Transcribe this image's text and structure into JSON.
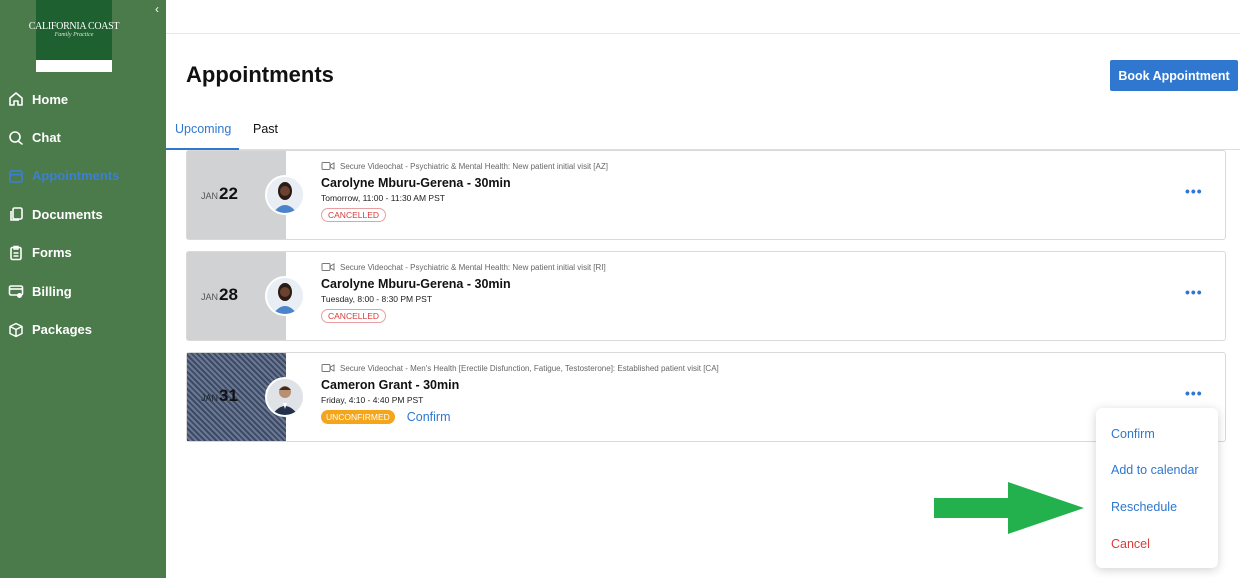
{
  "sidebar": {
    "logo_text": "CALIFORNIA COAST",
    "logo_subtext": "Family Practice",
    "items": [
      {
        "label": "Home",
        "icon": "home-icon"
      },
      {
        "label": "Chat",
        "icon": "chat-icon"
      },
      {
        "label": "Appointments",
        "icon": "calendar-icon",
        "active": true
      },
      {
        "label": "Documents",
        "icon": "documents-icon"
      },
      {
        "label": "Forms",
        "icon": "forms-icon"
      },
      {
        "label": "Billing",
        "icon": "billing-icon"
      },
      {
        "label": "Packages",
        "icon": "packages-icon"
      }
    ]
  },
  "header": {
    "title": "Appointments",
    "book_button": "Book Appointment"
  },
  "tabs": {
    "upcoming": "Upcoming",
    "past": "Past"
  },
  "appointments": [
    {
      "month": "JAN",
      "day": "22",
      "service": "Secure Videochat - Psychiatric & Mental Health: New patient initial visit [AZ]",
      "provider": "Carolyne Mburu-Gerena - 30min",
      "time": "Tomorrow, 11:00 - 11:30 AM PST",
      "status": "CANCELLED"
    },
    {
      "month": "JAN",
      "day": "28",
      "service": "Secure Videochat - Psychiatric & Mental Health: New patient initial visit [RI]",
      "provider": "Carolyne Mburu-Gerena - 30min",
      "time": "Tuesday, 8:00 - 8:30 PM PST",
      "status": "CANCELLED"
    },
    {
      "month": "JAN",
      "day": "31",
      "service": "Secure Videochat - Men's Health [Erectile Disfunction, Fatigue, Testosterone]: Established patient visit [CA]",
      "provider": "Cameron Grant - 30min",
      "time": "Friday, 4:10 - 4:40 PM PST",
      "status": "UNCONFIRMED",
      "confirm_label": "Confirm"
    }
  ],
  "menu": {
    "confirm": "Confirm",
    "add_to_calendar": "Add to calendar",
    "reschedule": "Reschedule",
    "cancel": "Cancel"
  },
  "colors": {
    "sidebar_bg": "#4b7a4b",
    "accent": "#2f77cf",
    "cancel_red": "#d93a3a",
    "unconfirmed_orange": "#f3a51b",
    "arrow_green": "#22b14c"
  }
}
